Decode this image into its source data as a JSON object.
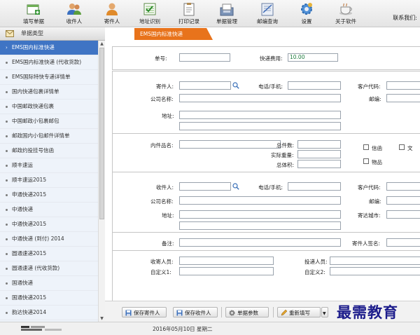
{
  "toolbar": {
    "items": [
      {
        "label": "填写单据",
        "icon": "form-fill-icon"
      },
      {
        "label": "收件人",
        "icon": "recipients-icon"
      },
      {
        "label": "寄件人",
        "icon": "sender-icon"
      },
      {
        "label": "地址识别",
        "icon": "address-recognition-icon"
      },
      {
        "label": "打印记录",
        "icon": "print-log-icon"
      },
      {
        "label": "单据管理",
        "icon": "document-management-icon"
      },
      {
        "label": "邮编查询",
        "icon": "postcode-query-icon"
      },
      {
        "label": "设置",
        "icon": "settings-gear-icon"
      },
      {
        "label": "关于软件",
        "icon": "about-cup-icon"
      }
    ],
    "contact_label": "联系我们:"
  },
  "sidebar": {
    "header": "单据类型",
    "items": [
      "EMS国内标准快递",
      "EMS国内标准快递 (代收货款)",
      "EMS国际特快专递详情单",
      "国内快递包裹详情单",
      "中国邮政快递包裹",
      "中国邮政小包裹邮包",
      "邮政国内小包邮件详情单",
      "邮政约投挂号信函",
      "顺丰速运",
      "顺丰速运2015",
      "申通快递2015",
      "中通快递",
      "中通快递2015",
      "中通快递 (到付) 2014",
      "圆通速递2015",
      "圆通速递 (代收货款)",
      "国通快递",
      "国通快递2015",
      "韵达快递2014"
    ],
    "active_index": 0
  },
  "tab": {
    "label": "EMS国内标准快递"
  },
  "form": {
    "order_no_label": "单号:",
    "order_no_value": "",
    "fee_label": "快递费用:",
    "fee_value": "10.00",
    "sender_label": "寄件人:",
    "phone_label": "电话/手机:",
    "customer_code_label": "客户代码:",
    "company_label": "公司名称:",
    "postcode_label": "邮编:",
    "address_label": "地址:",
    "item_name_label": "内件品名:",
    "total_pieces_label": "总件数:",
    "actual_weight_label": "实际重量:",
    "total_volume_label": "总体积:",
    "type_doc_label": "信函",
    "type_file_label": "文",
    "type_goods_label": "物品",
    "recipient_label": "收件人:",
    "r_phone_label": "电话/手机:",
    "r_customer_code_label": "客户代码:",
    "r_company_label": "公司名称:",
    "r_postcode_label": "邮编:",
    "r_address_label": "地址:",
    "dest_city_label": "寄达城市:",
    "remark_label": "备注:",
    "sender_sign_label": "寄件人签名:",
    "collector_label": "收寄人员:",
    "deliverer_label": "投递人员:",
    "custom1_label": "自定义1:",
    "custom2_label": "自定义2:"
  },
  "buttons": {
    "save_sender": "保存寄件人",
    "save_recipient": "保存收件人",
    "order_params": "单据参数",
    "refill": "重新填写"
  },
  "status": {
    "date": "2016年05月10日 星期二"
  },
  "watermark": "最需教育",
  "colors": {
    "accent": "#e8731b",
    "selected": "#3f74c4",
    "fee_text": "#1b7b3b",
    "watermark": "#1d1d8c"
  }
}
